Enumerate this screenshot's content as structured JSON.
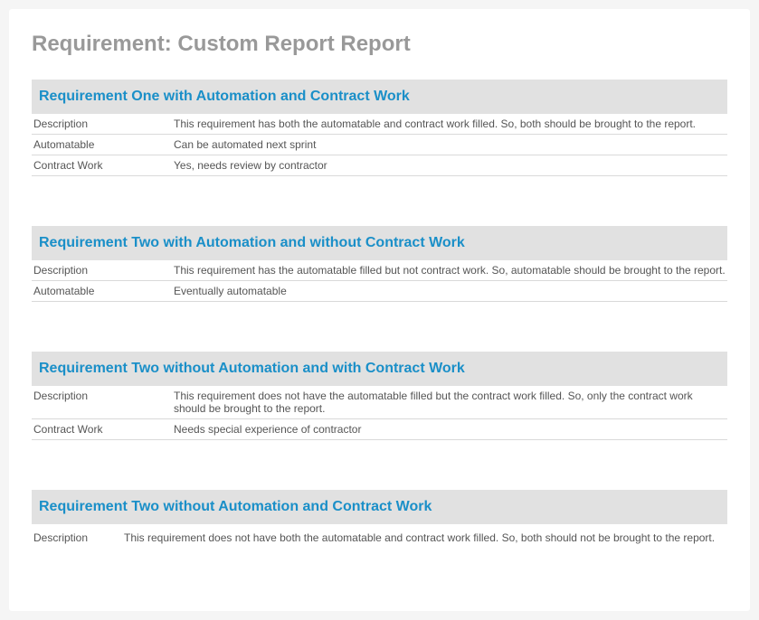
{
  "page_title": "Requirement: Custom Report Report",
  "labels": {
    "description": "Description",
    "automatable": "Automatable",
    "contract_work": "Contract Work"
  },
  "sections": [
    {
      "title": "Requirement One with Automation and Contract Work",
      "description": "This requirement has both the automatable and contract work filled. So, both should be brought to the report.",
      "automatable": "Can be automated next sprint",
      "contract_work": "Yes, needs review by contractor"
    },
    {
      "title": "Requirement Two with Automation and without Contract Work",
      "description": "This requirement has the automatable filled but not contract work. So, automatable should be brought to the report.",
      "automatable": "Eventually automatable"
    },
    {
      "title": "Requirement Two without Automation and with Contract Work",
      "description": "This requirement does not have the automatable filled but the contract work filled. So, only the contract work should be brought to the report.",
      "contract_work": "Needs special experience of contractor"
    },
    {
      "title": "Requirement Two without Automation and Contract Work",
      "description": "This requirement does not have both the automatable and contract work filled. So, both should not be brought to the report."
    }
  ]
}
